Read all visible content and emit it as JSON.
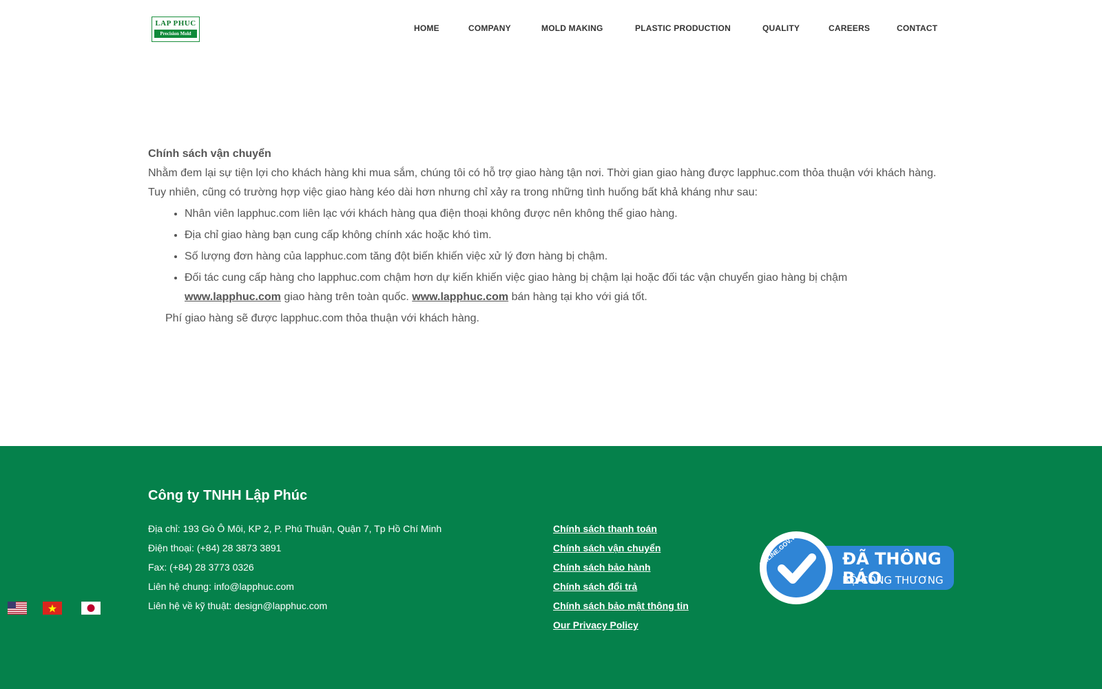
{
  "logo": {
    "line1": "LAP PHUC",
    "line2": "Precision Mold"
  },
  "nav": [
    {
      "label": "HOME"
    },
    {
      "label": "COMPANY"
    },
    {
      "label": "MOLD MAKING"
    },
    {
      "label": "PLASTIC PRODUCTION"
    },
    {
      "label": "QUALITY"
    },
    {
      "label": "CAREERS"
    },
    {
      "label": "CONTACT"
    }
  ],
  "content": {
    "title": "Chính sách vận chuyển",
    "intro": "Nhằm đem lại sự tiện lợi cho khách hàng khi mua sắm, chúng tôi có hỗ trợ giao hàng tận nơi. Thời gian giao hàng được lapphuc.com thỏa thuận với khách hàng.",
    "note": "Tuy nhiên, cũng có trường hợp việc giao hàng kéo dài hơn nhưng chỉ xảy ra trong những tình huống bất khả kháng như sau:",
    "bullets": [
      "Nhân viên lapphuc.com  liên lạc với khách hàng qua điện thoại không được nên không thể giao hàng.",
      "Địa chỉ giao hàng bạn cung cấp không chính xác hoặc khó tìm.",
      "Số lượng đơn hàng của lapphuc.com tăng đột biến khiến việc xử lý đơn hàng bị chậm."
    ],
    "bullet4_text": "Đối tác cung cấp hàng cho lapphuc.com chậm hơn dự kiến khiến việc giao hàng bị chậm lại hoặc đối tác vận chuyển giao hàng bị chậm",
    "bullet4_link1": "www.lapphuc.com",
    "bullet4_mid": " giao hàng trên toàn quốc. ",
    "bullet4_link2": "www.lapphuc.com",
    "bullet4_end": " bán hàng tại kho với giá tốt.",
    "fee": "Phí giao hàng sẽ được lapphuc.com thỏa thuận với khách hàng."
  },
  "footer": {
    "company": "Công ty TNHH Lập Phúc",
    "address": "Địa chỉ: 193 Gò Ô Môi, KP 2, P. Phú Thuận, Quận 7, Tp Hồ Chí Minh",
    "phone": "Điện thoại: (+84) 28 3873 3891",
    "fax": "Fax: (+84) 28 3773 0326",
    "email_general": "Liên hệ chung: info@lapphuc.com",
    "email_tech": "Liên hệ về kỹ thuật: design@lapphuc.com",
    "policies": [
      "Chính sách thanh toán",
      "Chính sách vận chuyển",
      "Chính sách bảo hành",
      "Chính sách đổi trả",
      "Chính sách bảo mật thông tin",
      "Our Privacy Policy"
    ],
    "badge": {
      "line1": "ĐÃ THÔNG BÁO",
      "line2": "BỘ CÔNG THƯƠNG",
      "arc": "ONLINE.GOV.VN"
    }
  },
  "flags": [
    {
      "icon": "us-flag-icon"
    },
    {
      "icon": "vn-flag-icon"
    },
    {
      "icon": "jp-flag-icon"
    }
  ],
  "colors": {
    "footer_bg": "#05814b",
    "badge_blue": "#2f85d6",
    "logo_green": "#0f8a3a"
  }
}
